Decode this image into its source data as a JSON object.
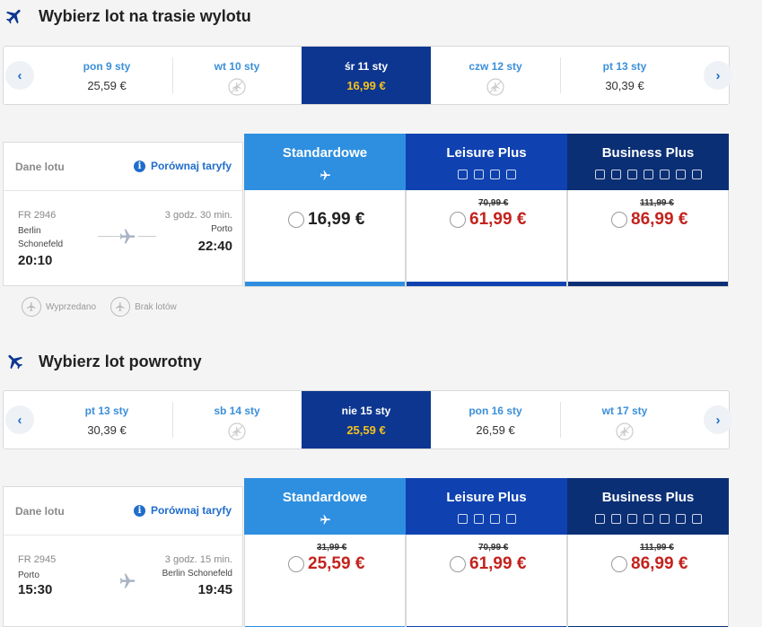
{
  "outbound": {
    "title": "Wybierz lot na trasie wylotu",
    "dates": [
      {
        "day": "pon 9 sty",
        "price": "25,59 €",
        "available": true,
        "active": false
      },
      {
        "day": "wt 10 sty",
        "price": "",
        "available": false,
        "active": false
      },
      {
        "day": "śr 11 sty",
        "price": "16,99 €",
        "available": true,
        "active": true
      },
      {
        "day": "czw 12 sty",
        "price": "",
        "available": false,
        "active": false
      },
      {
        "day": "pt 13 sty",
        "price": "30,39 €",
        "available": true,
        "active": false
      }
    ],
    "flight": {
      "header_label": "Dane lotu",
      "compare_label": "Porównaj taryfy",
      "number": "FR 2946",
      "from": "Berlin Schonefeld",
      "departure": "20:10",
      "duration": "3 godz. 30 min.",
      "to": "Porto",
      "arrival": "22:40"
    },
    "fares": [
      {
        "name": "Standardowe",
        "old_price": "",
        "price": "16,99 €"
      },
      {
        "name": "Leisure Plus",
        "old_price": "70,99 €",
        "price": "61,99 €"
      },
      {
        "name": "Business Plus",
        "old_price": "111,99 €",
        "price": "86,99 €"
      }
    ]
  },
  "legend": {
    "sold_out": "Wyprzedano",
    "no_flights": "Brak lotów"
  },
  "return": {
    "title": "Wybierz lot powrotny",
    "dates": [
      {
        "day": "pt 13 sty",
        "price": "30,39 €",
        "available": true,
        "active": false
      },
      {
        "day": "sb 14 sty",
        "price": "",
        "available": false,
        "active": false
      },
      {
        "day": "nie 15 sty",
        "price": "25,59 €",
        "available": true,
        "active": true
      },
      {
        "day": "pon 16 sty",
        "price": "26,59 €",
        "available": true,
        "active": false
      },
      {
        "day": "wt 17 sty",
        "price": "",
        "available": false,
        "active": false
      }
    ],
    "flight": {
      "header_label": "Dane lotu",
      "compare_label": "Porównaj taryfy",
      "number": "FR 2945",
      "from": "Porto",
      "departure": "15:30",
      "duration": "3 godz. 15 min.",
      "to": "Berlin Schonefeld",
      "arrival": "19:45"
    },
    "fares": [
      {
        "name": "Standardowe",
        "old_price": "31,99 €",
        "price": "25,59 €"
      },
      {
        "name": "Leisure Plus",
        "old_price": "70,99 €",
        "price": "61,99 €"
      },
      {
        "name": "Business Plus",
        "old_price": "111,99 €",
        "price": "86,99 €"
      }
    ]
  },
  "colors": {
    "accent_blue": "#3b8fd9",
    "active_date_bg": "#0d3690",
    "active_price": "#f4c21d",
    "standard": "#2e8fe0",
    "leisure": "#0f42b0",
    "business": "#0b2f75",
    "discount_price": "#c3231e"
  }
}
